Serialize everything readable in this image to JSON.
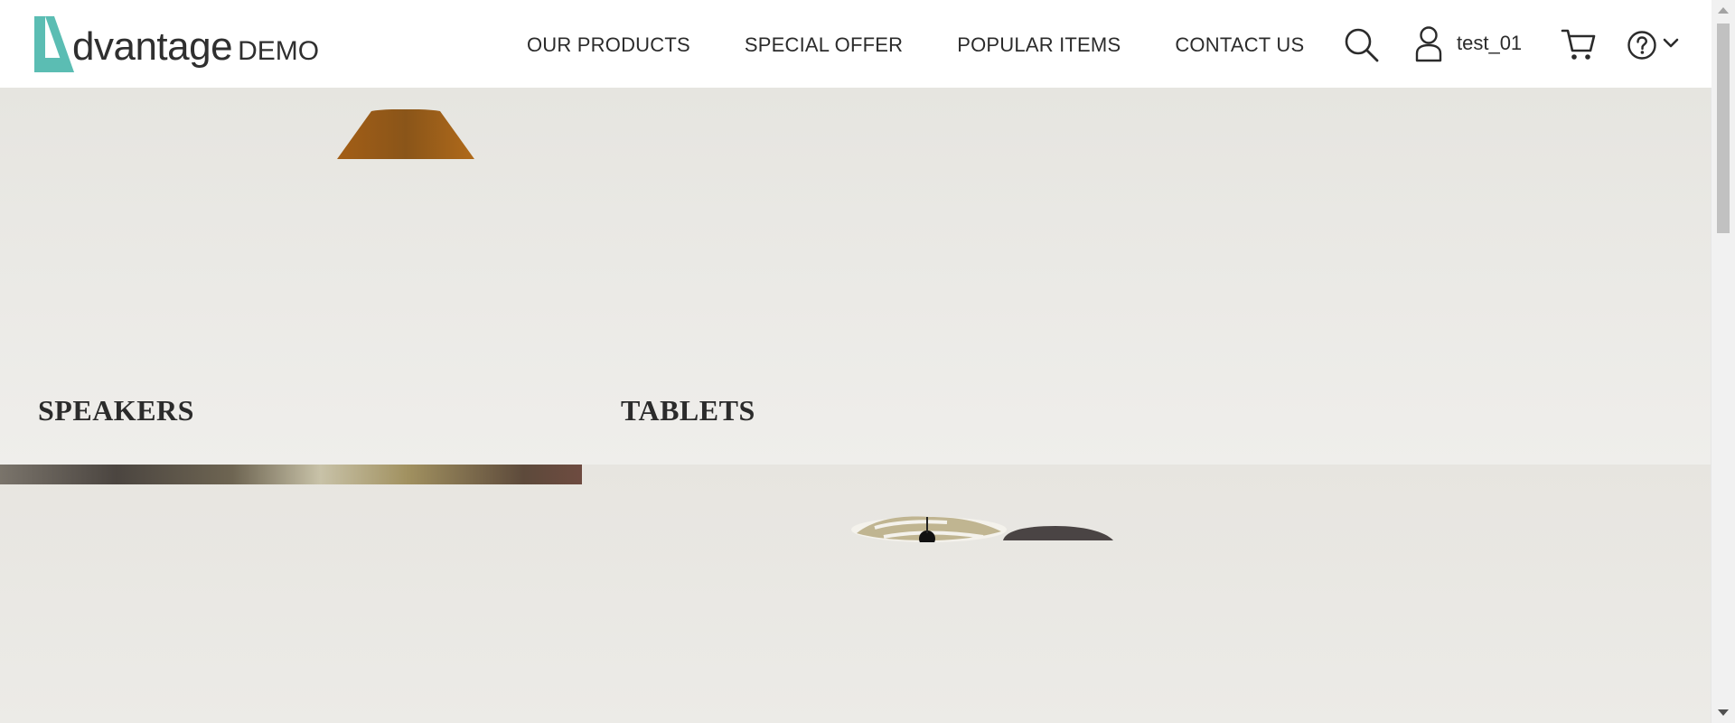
{
  "brand": {
    "name": "dvantage",
    "suffix": "DEMO",
    "accent": "#5bbdb3"
  },
  "nav": {
    "items": [
      {
        "label": "OUR PRODUCTS"
      },
      {
        "label": "SPECIAL OFFER"
      },
      {
        "label": "POPULAR ITEMS"
      },
      {
        "label": "CONTACT US"
      }
    ]
  },
  "header_icons": {
    "search": "search-icon",
    "user": "user-icon",
    "cart": "cart-icon",
    "help": "help-icon",
    "dropdown": "chevron-down-icon"
  },
  "user": {
    "name": "test_01"
  },
  "categories": {
    "left": {
      "title": "SPEAKERS"
    },
    "right": {
      "title": "TABLETS"
    }
  }
}
